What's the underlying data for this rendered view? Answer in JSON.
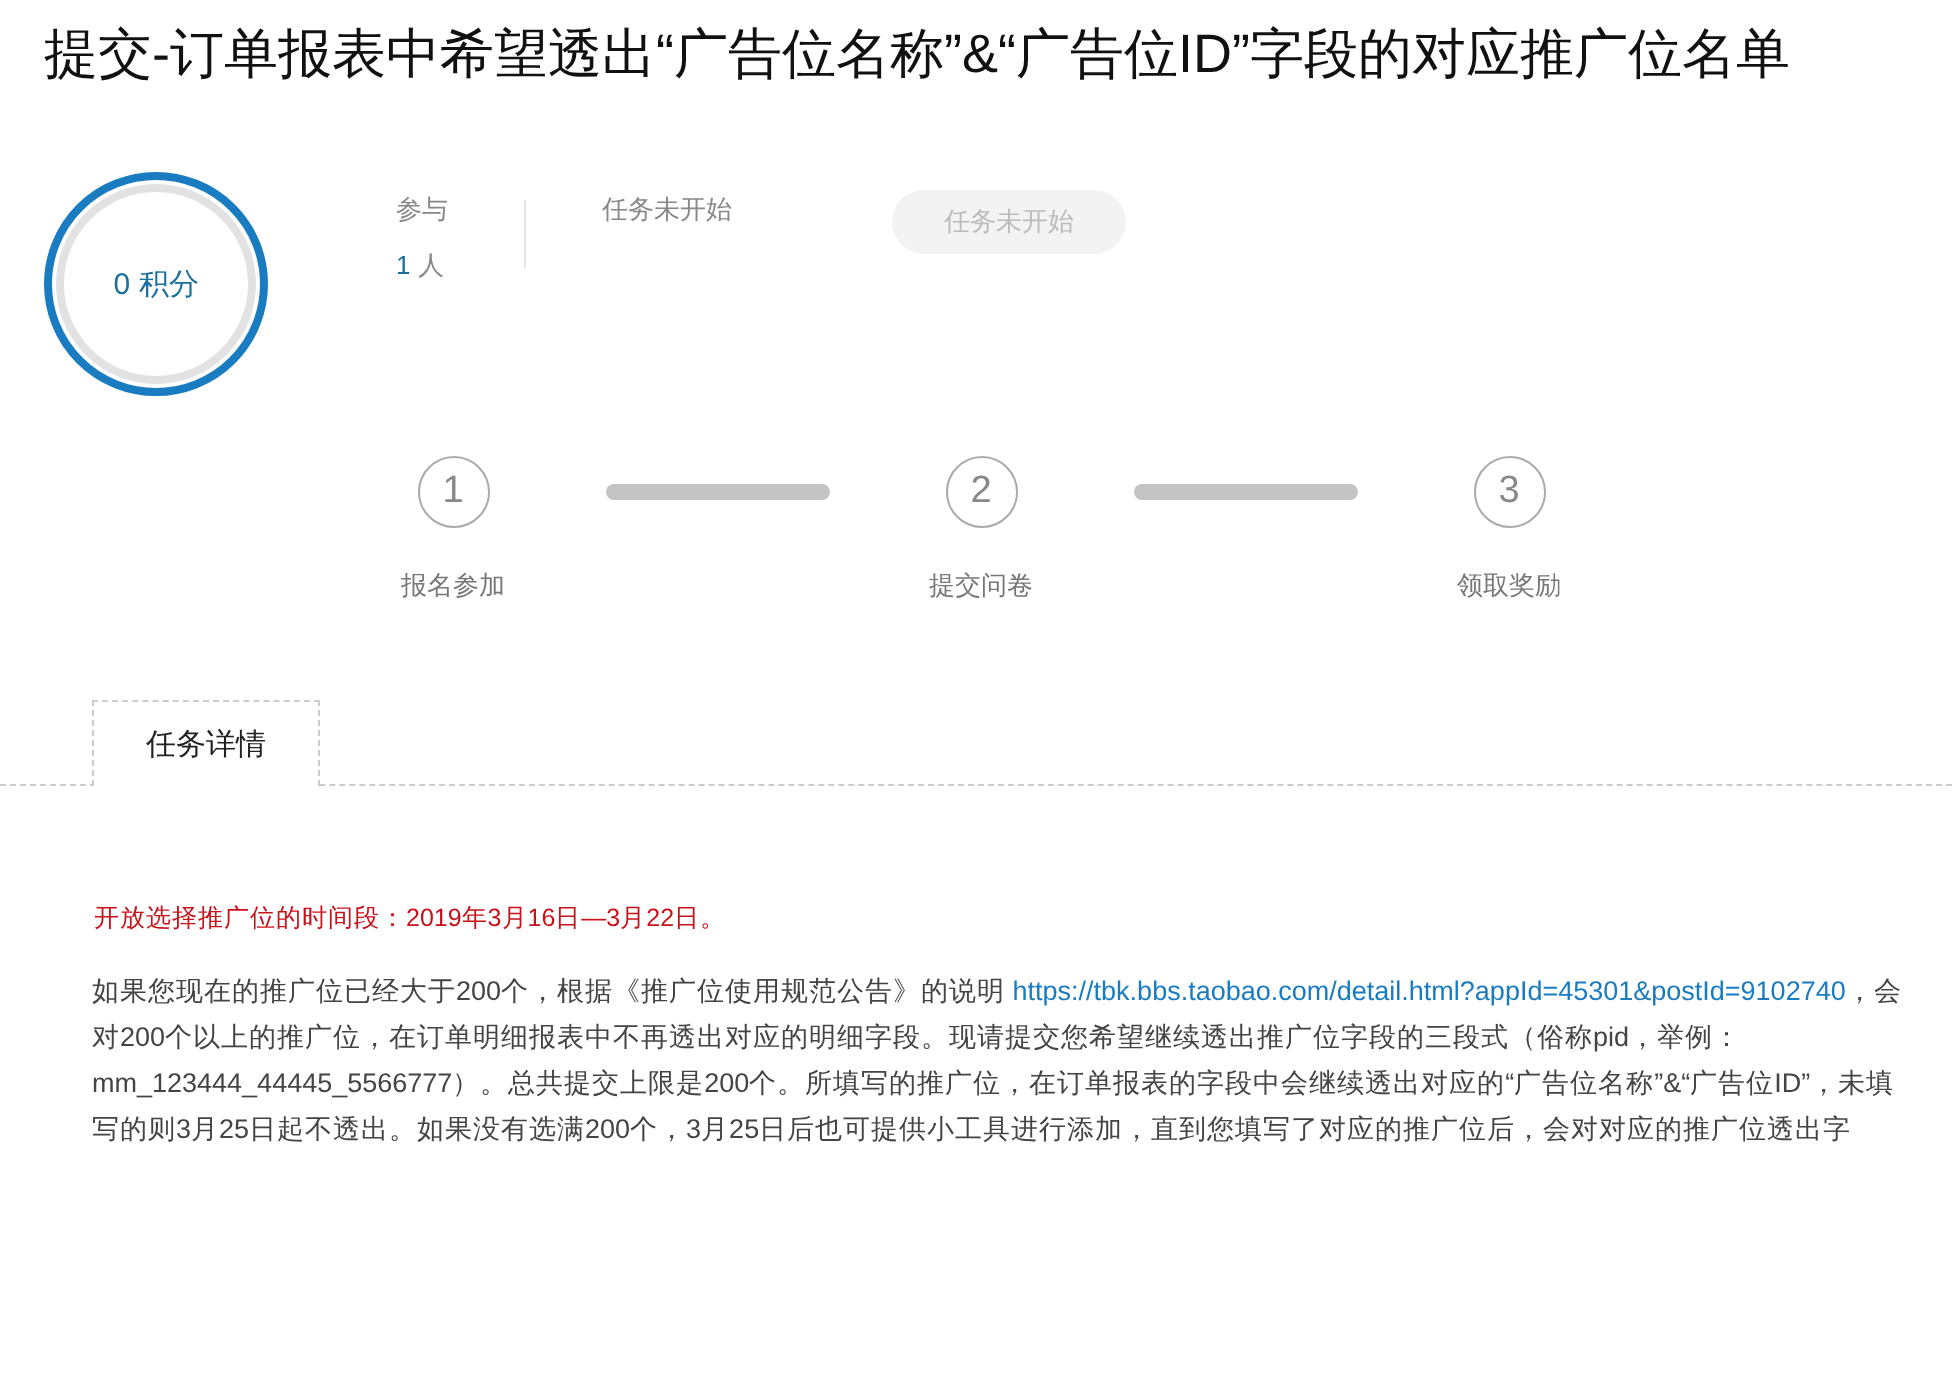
{
  "title": "提交-订单报表中希望透出“广告位名称”&“广告位ID”字段的对应推广位名单",
  "score": {
    "value": "0",
    "unit": "积分"
  },
  "participants": {
    "label": "参与",
    "count": "1",
    "unit": "人"
  },
  "status": "任务未开始",
  "action_button": {
    "label": "任务未开始",
    "disabled": true
  },
  "steps": [
    {
      "number": "1",
      "label": "报名参加"
    },
    {
      "number": "2",
      "label": "提交问卷"
    },
    {
      "number": "3",
      "label": "领取奖励"
    }
  ],
  "tabs": [
    {
      "label": "任务详情",
      "selected": true
    }
  ],
  "notice": "开放选择推广位的时间段：2019年3月16日—3月22日。",
  "paragraph": [
    {
      "kind": "text",
      "text": "如果您现在的推广位已经大于200个，根据《推广位使用规范公告》的说明 "
    },
    {
      "kind": "link",
      "text": "https://tbk.bbs.taobao.com/detail.html?"
    },
    {
      "kind": "link",
      "text": "appId=45301&postId=9102740"
    },
    {
      "kind": "text",
      "text": "，会对200个以上的推广位，在订单明细报表中不再透出对应的明细字段。现请提交您希望继续透出推广位字段的三段式（俗称pid，举例：mm_123444_44445_5566777）。总共提交上限是200个。所填写的推广位，在订单报表的字段中会继续透出对应的“广告位名称”&“广告位ID”，未填写的则3月25日起不透出。如果没有选满200个，3月25日后也可提供小工具进行添加，直到您填写了对应的推广位后，会对对应的推广位透出字"
    }
  ]
}
